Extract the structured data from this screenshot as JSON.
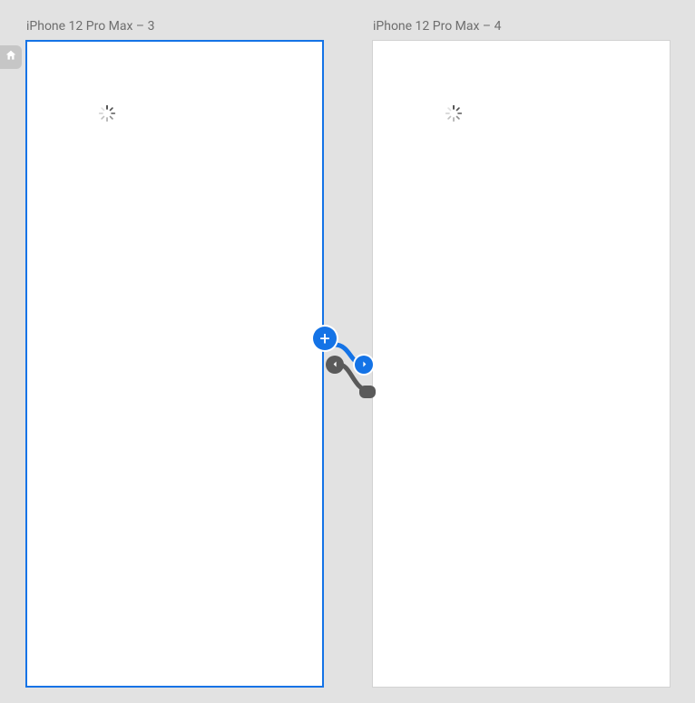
{
  "colors": {
    "canvasBg": "#e2e2e2",
    "artboardBg": "#ffffff",
    "selection": "#1473e6",
    "muted": "#5a5a5a"
  },
  "homeTab": {
    "icon": "home-icon"
  },
  "artboards": [
    {
      "id": "ab1",
      "label": "iPhone 12 Pro Max – 3",
      "selected": true
    },
    {
      "id": "ab2",
      "label": "iPhone 12 Pro Max – 4",
      "selected": false
    }
  ],
  "prototypeControls": {
    "addInteraction": {
      "glyph": "+"
    },
    "prevLink": {
      "icon": "chevron-left-icon"
    },
    "nextLink": {
      "icon": "chevron-right-icon"
    }
  }
}
